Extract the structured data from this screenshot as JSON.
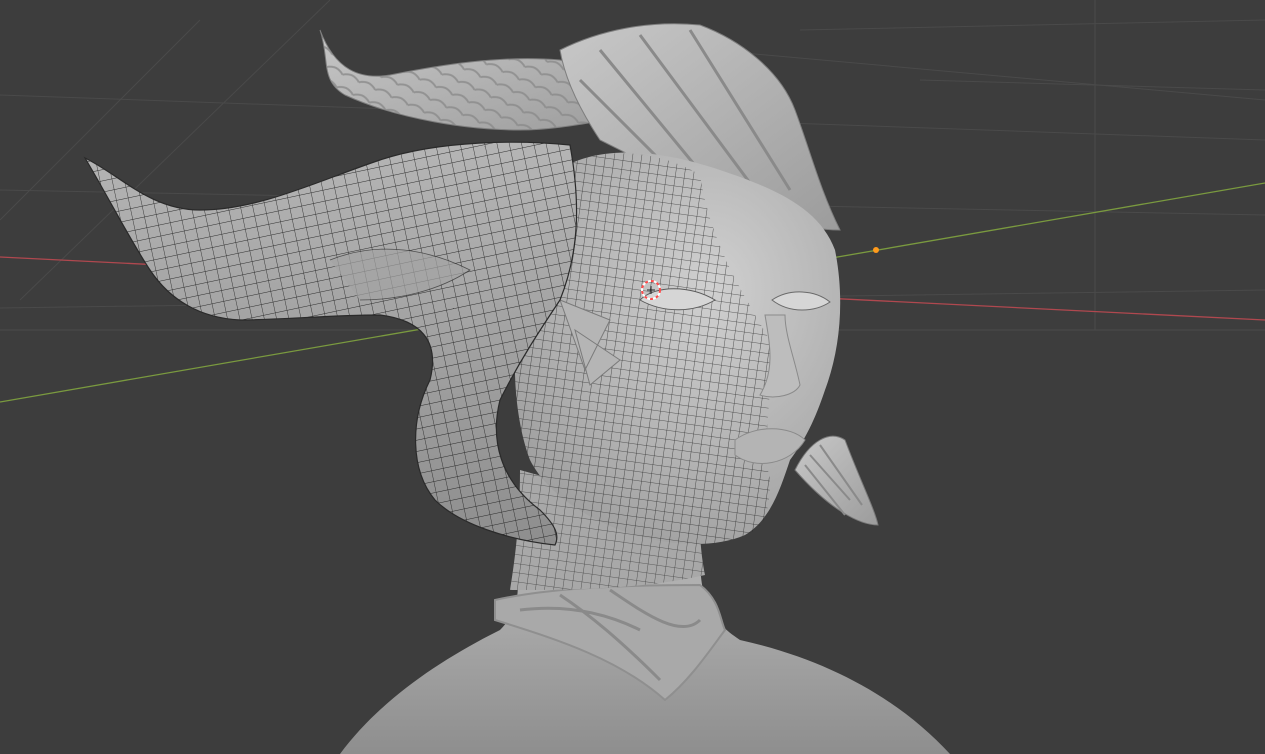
{
  "viewport": {
    "background_color": "#3d3d3d",
    "grid_color": "#4a4a4a",
    "x_axis_color": "#b0484f",
    "y_axis_color": "#7a9a3f",
    "mesh_color": "#b8b8b8",
    "wire_color": "#1c1c1c",
    "origin_color": "#ff9a1c",
    "cursor_color": "#ff4b4b",
    "cursor_inner_color": "#ffffff",
    "icons": {
      "cursor": "3d-cursor-icon",
      "origin": "object-origin-icon"
    }
  }
}
